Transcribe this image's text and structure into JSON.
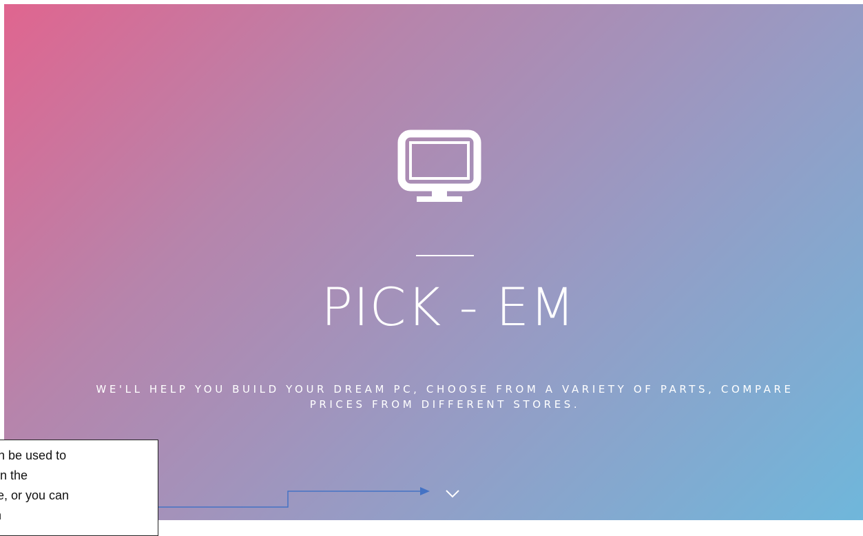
{
  "hero": {
    "title": "PICK - EM",
    "subtitle": "WE'LL HELP YOU BUILD YOUR DREAM PC, CHOOSE FROM A VARIETY OF PARTS, COMPARE PRICES FROM DIFFERENT STORES.",
    "icon": "monitor-icon",
    "scroll_icon": "chevron-down-icon"
  },
  "colors": {
    "gradient_start": "#e0658f",
    "gradient_mid": "#979bc4",
    "gradient_end": "#6fb7db",
    "arrow": "#4472c4"
  },
  "annotation": {
    "lines": [
      "an be used to",
      "wn the",
      "ite, or you can",
      "th"
    ]
  }
}
